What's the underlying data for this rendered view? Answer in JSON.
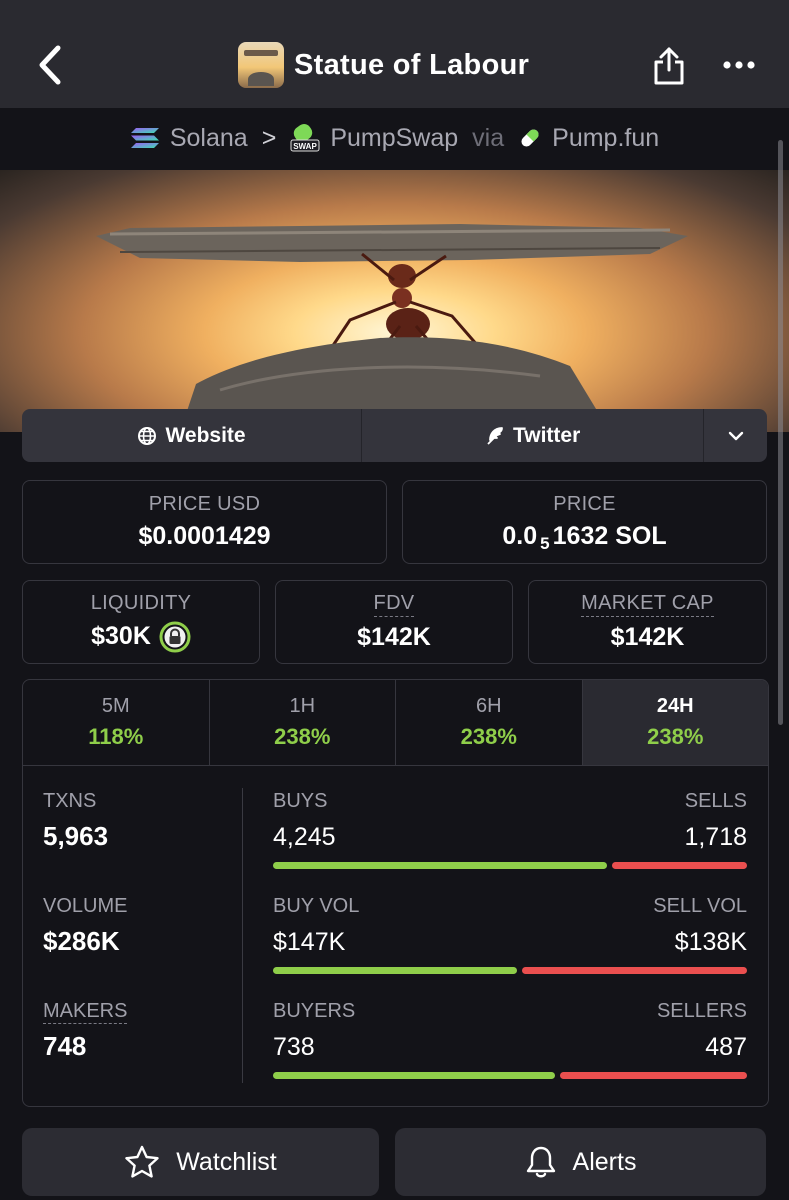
{
  "header": {
    "title": "Statue of Labour"
  },
  "chain": {
    "network": "Solana",
    "sep": ">",
    "dex": "PumpSwap",
    "via": "via",
    "launchpad": "Pump.fun",
    "dex_badge": "SWAP"
  },
  "links": {
    "website": "Website",
    "twitter": "Twitter"
  },
  "price": {
    "usd_label": "PRICE USD",
    "usd_value": "$0.0001429",
    "native_label": "PRICE",
    "native_prefix": "0.0",
    "native_zeros": "5",
    "native_rest": "1632 SOL"
  },
  "metrics": {
    "liquidity_label": "LIQUIDITY",
    "liquidity_value": "$30K",
    "fdv_label": "FDV",
    "fdv_value": "$142K",
    "mcap_label": "MARKET CAP",
    "mcap_value": "$142K"
  },
  "tabs": [
    {
      "label": "5M",
      "value": "118%"
    },
    {
      "label": "1H",
      "value": "238%"
    },
    {
      "label": "6H",
      "value": "238%"
    },
    {
      "label": "24H",
      "value": "238%"
    }
  ],
  "stats": {
    "txns_label": "TXNS",
    "txns_value": "5,963",
    "volume_label": "VOLUME",
    "volume_value": "$286K",
    "makers_label": "MAKERS",
    "makers_value": "748",
    "buys_label": "BUYS",
    "buys_value": "4,245",
    "sells_label": "SELLS",
    "sells_value": "1,718",
    "buy_share": 0.71,
    "buyvol_label": "BUY VOL",
    "buyvol_value": "$147K",
    "sellvol_label": "SELL VOL",
    "sellvol_value": "$138K",
    "buyvol_share": 0.52,
    "buyers_label": "BUYERS",
    "buyers_value": "738",
    "sellers_label": "SELLERS",
    "sellers_value": "487",
    "buyers_share": 0.6
  },
  "actions": {
    "watchlist": "Watchlist",
    "alerts": "Alerts"
  },
  "colors": {
    "accent_green": "#8fce4a",
    "accent_red": "#ea4f4f",
    "surface": "#2a2a30"
  }
}
